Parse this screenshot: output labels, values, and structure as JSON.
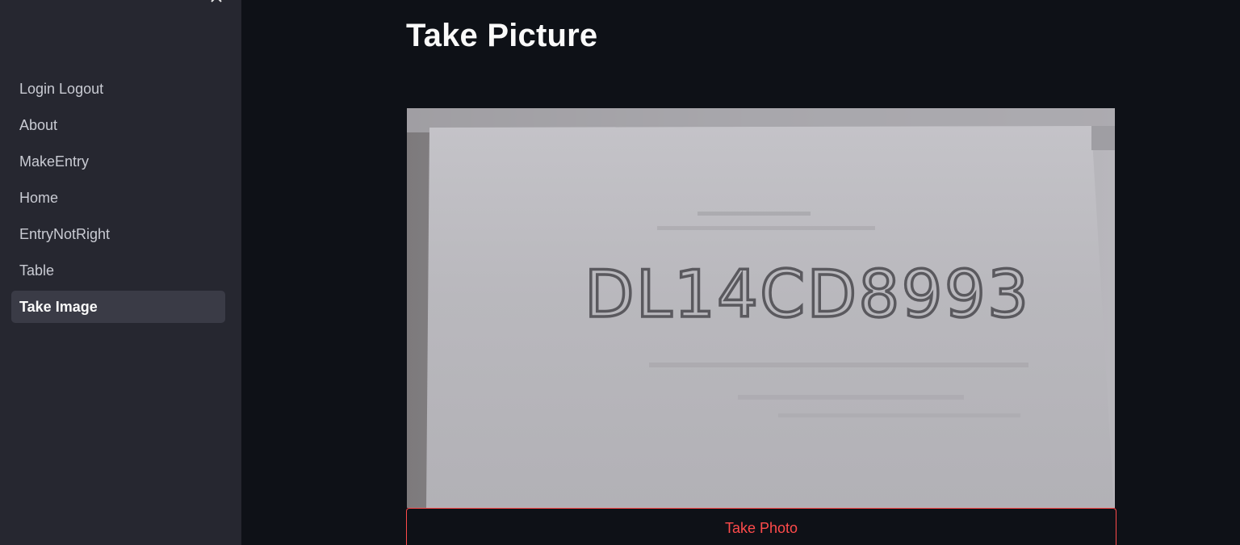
{
  "sidebar": {
    "close_icon": "close-icon",
    "items": [
      {
        "label": "Login Logout",
        "active": false
      },
      {
        "label": "About",
        "active": false
      },
      {
        "label": "MakeEntry",
        "active": false
      },
      {
        "label": "Home",
        "active": false
      },
      {
        "label": "EntryNotRight",
        "active": false
      },
      {
        "label": "Table",
        "active": false
      },
      {
        "label": "Take Image",
        "active": true
      }
    ]
  },
  "main": {
    "title": "Take Picture",
    "camera": {
      "plate_text": "DL14CD8993"
    },
    "take_photo_label": "Take Photo"
  },
  "colors": {
    "background": "#0e1117",
    "sidebar": "#262730",
    "active_item": "#3a3b46",
    "accent": "#ff4b4b"
  }
}
